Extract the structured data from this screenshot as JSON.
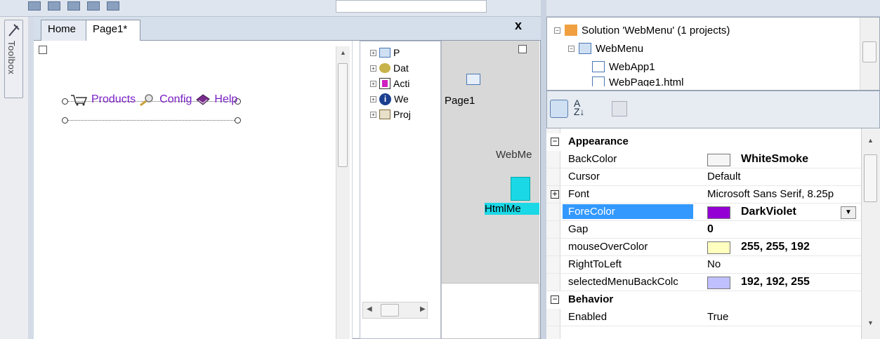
{
  "toolbox": {
    "label": "Toolbox"
  },
  "editor": {
    "tabs": [
      {
        "label": "Home"
      },
      {
        "label": "Page1*"
      }
    ],
    "close": "x",
    "menu_items": [
      {
        "label": "Products",
        "icon": "cart-icon"
      },
      {
        "label": "Config",
        "icon": "magnifier-icon"
      },
      {
        "label": "Help",
        "icon": "book-icon"
      }
    ]
  },
  "tree": {
    "items": [
      "P",
      "Dat",
      "Acti",
      "We",
      "Proj"
    ]
  },
  "diagram": {
    "page_label": "Page1",
    "webmenu_label": "WebMe",
    "htmlmenu_label": "HtmlMe"
  },
  "solution": {
    "items": [
      "Solution 'WebMenu' (1 projects)",
      "WebMenu",
      "WebApp1",
      "WebPage1.html"
    ]
  },
  "properties": {
    "toolbar_icons": [
      "categorized-icon",
      "alphabetical-icon",
      "property-pages-icon"
    ],
    "rows": [
      {
        "kind": "category",
        "name": "Appearance"
      },
      {
        "name": "BackColor",
        "swatch": "#f5f5f5",
        "value": "WhiteSmoke",
        "bold": true
      },
      {
        "name": "Cursor",
        "value": "Default"
      },
      {
        "name": "Font",
        "value": "Microsoft Sans Serif, 8.25p",
        "expand": true
      },
      {
        "name": "ForeColor",
        "swatch": "#9400d3",
        "value": "DarkViolet",
        "bold": true,
        "selected": true
      },
      {
        "name": "Gap",
        "value": "0",
        "bold": true
      },
      {
        "name": "mouseOverColor",
        "swatch": "#ffffc0",
        "value": "255, 255, 192",
        "bold": true
      },
      {
        "name": "RightToLeft",
        "value": "No"
      },
      {
        "name": "selectedMenuBackColc",
        "swatch": "#c0c0ff",
        "value": "192, 192, 255",
        "bold": true
      },
      {
        "kind": "category",
        "name": "Behavior"
      },
      {
        "name": "Enabled",
        "value": "True"
      }
    ]
  },
  "colors": {
    "menu_text": "#7a1fc4",
    "selection": "#3399ff",
    "diagram_bg": "#d8d8d8"
  }
}
